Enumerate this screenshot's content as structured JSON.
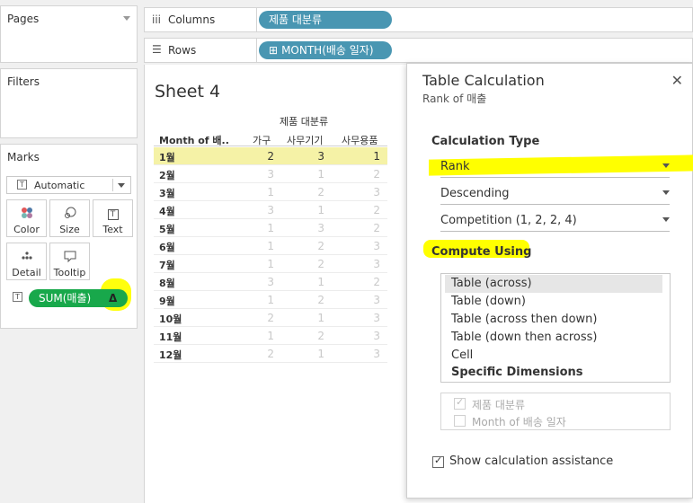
{
  "left_panel": {
    "pages_title": "Pages",
    "filters_title": "Filters",
    "marks_title": "Marks",
    "marks_type": "Automatic",
    "mark_buttons": [
      "Color",
      "Size",
      "Text",
      "Detail",
      "Tooltip"
    ],
    "measure_pill": "SUM(매출)",
    "measure_pill_delta": "Δ"
  },
  "shelves": {
    "columns_label": "Columns",
    "columns_pill": "제품 대분류",
    "rows_label": "Rows",
    "rows_pill": "MONTH(배송 일자)",
    "rows_pill_prefix": "⊞"
  },
  "sheet": {
    "title": "Sheet 4",
    "column_group_header": "제품 대분류",
    "row_header": "Month of 배..",
    "columns": [
      "가구",
      "사무기기",
      "사무용품"
    ],
    "rows": [
      {
        "month": "1월",
        "values": [
          "2",
          "3",
          "1"
        ]
      },
      {
        "month": "2월",
        "values": [
          "3",
          "1",
          "2"
        ]
      },
      {
        "month": "3월",
        "values": [
          "1",
          "2",
          "3"
        ]
      },
      {
        "month": "4월",
        "values": [
          "3",
          "1",
          "2"
        ]
      },
      {
        "month": "5월",
        "values": [
          "1",
          "3",
          "2"
        ]
      },
      {
        "month": "6월",
        "values": [
          "1",
          "2",
          "3"
        ]
      },
      {
        "month": "7월",
        "values": [
          "1",
          "2",
          "3"
        ]
      },
      {
        "month": "8월",
        "values": [
          "3",
          "1",
          "2"
        ]
      },
      {
        "month": "9월",
        "values": [
          "1",
          "2",
          "3"
        ]
      },
      {
        "month": "10월",
        "values": [
          "2",
          "1",
          "3"
        ]
      },
      {
        "month": "11월",
        "values": [
          "1",
          "2",
          "3"
        ]
      },
      {
        "month": "12월",
        "values": [
          "2",
          "1",
          "3"
        ]
      }
    ]
  },
  "dialog": {
    "title": "Table Calculation",
    "subtitle": "Rank of 매출",
    "close_symbol": "✕",
    "calc_type_label": "Calculation Type",
    "calc_type_value": "Rank",
    "order_value": "Descending",
    "competition_value": "Competition (1, 2, 2, 4)",
    "compute_using_label": "Compute Using",
    "compute_options": [
      "Table (across)",
      "Table (down)",
      "Table (across then down)",
      "Table (down then across)",
      "Cell",
      "Specific Dimensions"
    ],
    "dimensions": [
      "제품 대분류",
      "Month of 배송 일자"
    ],
    "show_assistance_label": "Show calculation assistance"
  },
  "colors": {
    "pill_blue": "#4996b2",
    "pill_green": "#18a84b",
    "highlight_yellow": "#ffff00",
    "selected_row": "#f5f2a6"
  }
}
